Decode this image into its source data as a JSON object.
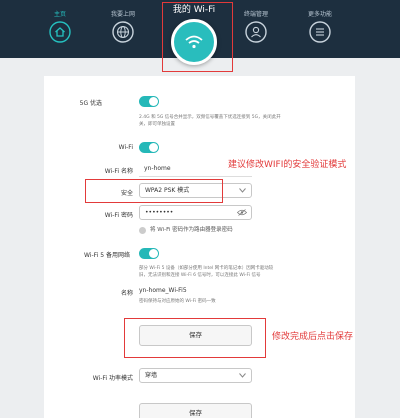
{
  "nav": {
    "home_label": "主页",
    "devices_label": "我要上网",
    "wifi_title": "我的 Wi-Fi",
    "terminal_label": "终端管理",
    "more_label": "更多功能"
  },
  "settings": {
    "band_5g_label": "5G 优选",
    "band_5g_desc_line1": "2.4G 和 5G 信号合并显示，双频信号覆盖下优选连接到 5G，关闭此开",
    "band_5g_desc_line2": "关，即可单独设置",
    "wifi_label": "Wi-Fi",
    "name_label": "Wi-Fi 名称",
    "name_value": "yn-home",
    "security_label": "安全",
    "security_value": "WPA2 PSK 模式",
    "password_label": "Wi-Fi 密码",
    "password_value": "••••••••",
    "admin_pw_checkbox_label": "将 Wi-Fi 密码作为路由器登录密码",
    "wifi5_backup_label": "Wi-Fi 5 备用网络",
    "wifi5_desc_line1": "部分 Wi-Fi 5 设备（如部分使用 Intel 网卡的笔记本）因网卡驱动较",
    "wifi5_desc_line2": "旧，无法识别和连接 Wi-Fi 6 信号时，可以连接此 Wi-Fi 信号",
    "wifi5_name_label": "名称",
    "wifi5_name_value": "yn-home_Wi-Fi5",
    "wifi5_name_note": "密码保持与对应原始的 Wi-Fi 密码一致",
    "save_label": "保存",
    "power_mode_label": "Wi-Fi 功率模式",
    "power_mode_value": "穿墙",
    "save2_label": "保存"
  },
  "annotations": {
    "security_note": "建议修改WIFI的安全验证模式",
    "save_note": "修改完成后点击保存"
  },
  "colors": {
    "nav_bg": "#1d2f3f",
    "accent": "#25b8b8",
    "annotation_red": "#e23a3a"
  }
}
